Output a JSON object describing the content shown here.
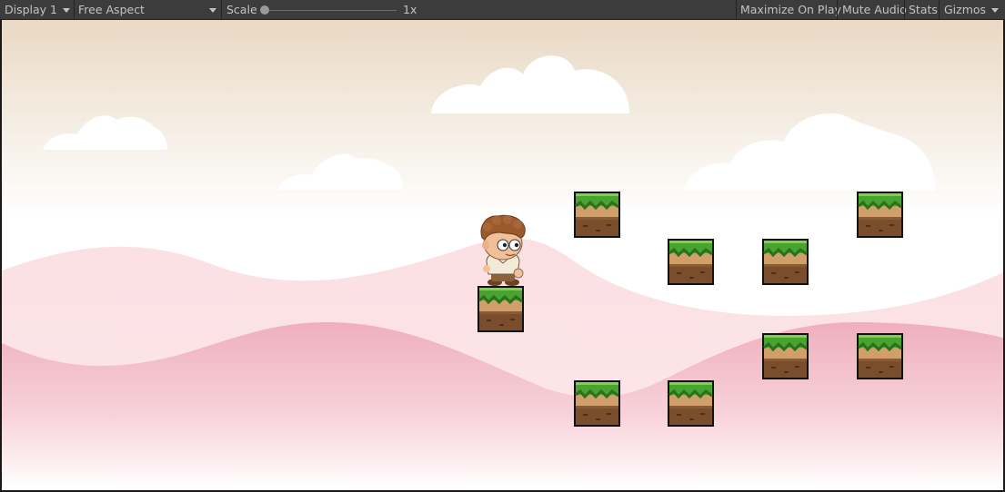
{
  "toolbar": {
    "display": "Display 1",
    "aspect": "Free Aspect",
    "scale_label": "Scale",
    "scale_value": "1x",
    "scale_level": 0,
    "maximize": "Maximize On Play",
    "mute": "Mute Audio",
    "stats": "Stats",
    "gizmos": "Gizmos"
  },
  "scene": {
    "character": "boy-character",
    "tile": "grass-dirt-block",
    "sky_colors": [
      "#e9d9c4",
      "#ffffff"
    ],
    "hill_colors": [
      "#f9d9df",
      "#eeaab8"
    ]
  }
}
